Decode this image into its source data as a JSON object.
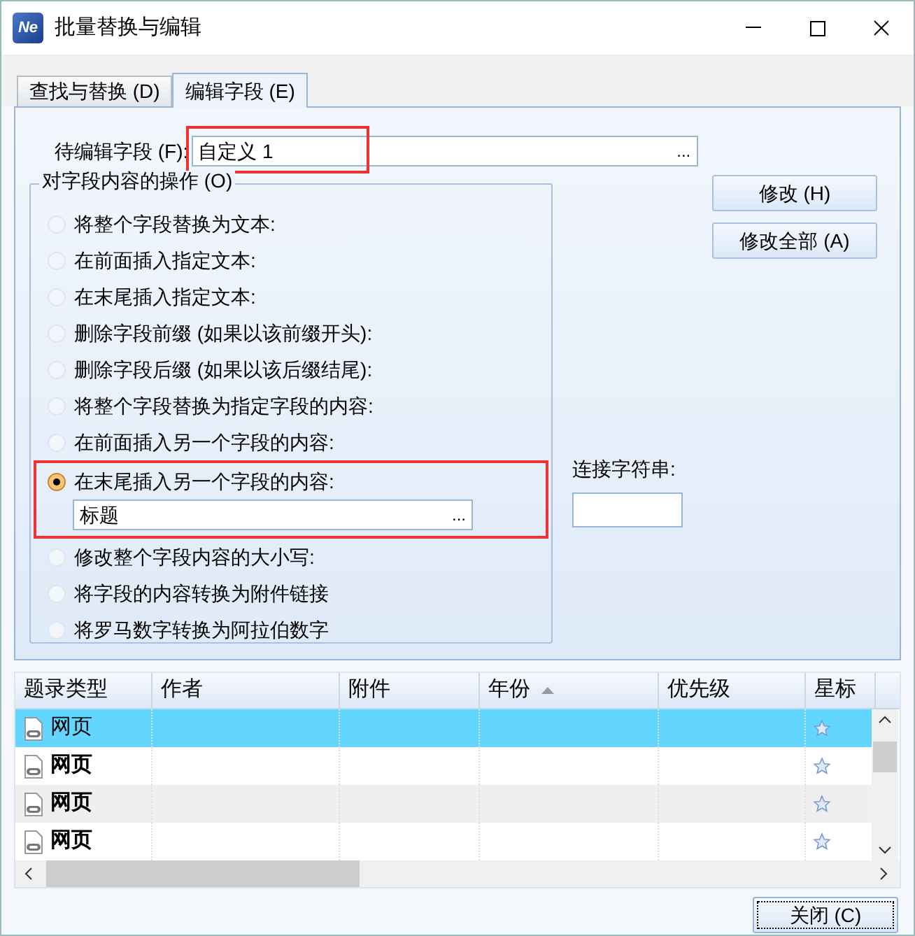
{
  "window": {
    "title": "批量替换与编辑",
    "app_icon": "Ne"
  },
  "tabs": [
    {
      "label": "查找与替换 (D)",
      "selected": false
    },
    {
      "label": "编辑字段 (E)",
      "selected": true
    }
  ],
  "field_to_edit": {
    "label": "待编辑字段 (F):",
    "value": "自定义 1",
    "button": "...",
    "highlighted": true
  },
  "operations": {
    "title": "对字段内容的操作 (O)",
    "options": [
      {
        "label": "将整个字段替换为文本:",
        "selected": false
      },
      {
        "label": "在前面插入指定文本:",
        "selected": false
      },
      {
        "label": "在末尾插入指定文本:",
        "selected": false
      },
      {
        "label": "删除字段前缀 (如果以该前缀开头):",
        "selected": false
      },
      {
        "label": "删除字段后缀 (如果以该后缀结尾):",
        "selected": false
      },
      {
        "label": "将整个字段替换为指定字段的内容:",
        "selected": false
      },
      {
        "label": "在前面插入另一个字段的内容:",
        "selected": false
      },
      {
        "label": "在末尾插入另一个字段的内容:",
        "selected": true,
        "highlighted": true,
        "field": {
          "value": "标题",
          "button": "..."
        }
      },
      {
        "label": "修改整个字段内容的大小写:",
        "selected": false
      },
      {
        "label": "将字段的内容转换为附件链接",
        "selected": false
      },
      {
        "label": "将罗马数字转换为阿拉伯数字",
        "selected": false
      }
    ]
  },
  "separator": {
    "label": "连接字符串:"
  },
  "buttons": [
    "修改 (H)",
    "修改全部 (A)"
  ],
  "table": {
    "columns": [
      {
        "label": "题录类型"
      },
      {
        "label": "作者"
      },
      {
        "label": "附件"
      },
      {
        "label": "年份",
        "sorted": true
      },
      {
        "label": "优先级"
      },
      {
        "label": "星标"
      }
    ],
    "rows": [
      {
        "type": "网页",
        "bold": false,
        "selected": true
      },
      {
        "type": "网页",
        "bold": true,
        "selected": false
      },
      {
        "type": "网页",
        "bold": true,
        "selected": false
      },
      {
        "type": "网页",
        "bold": true,
        "selected": false
      }
    ]
  },
  "close_button": "关闭 (C)"
}
